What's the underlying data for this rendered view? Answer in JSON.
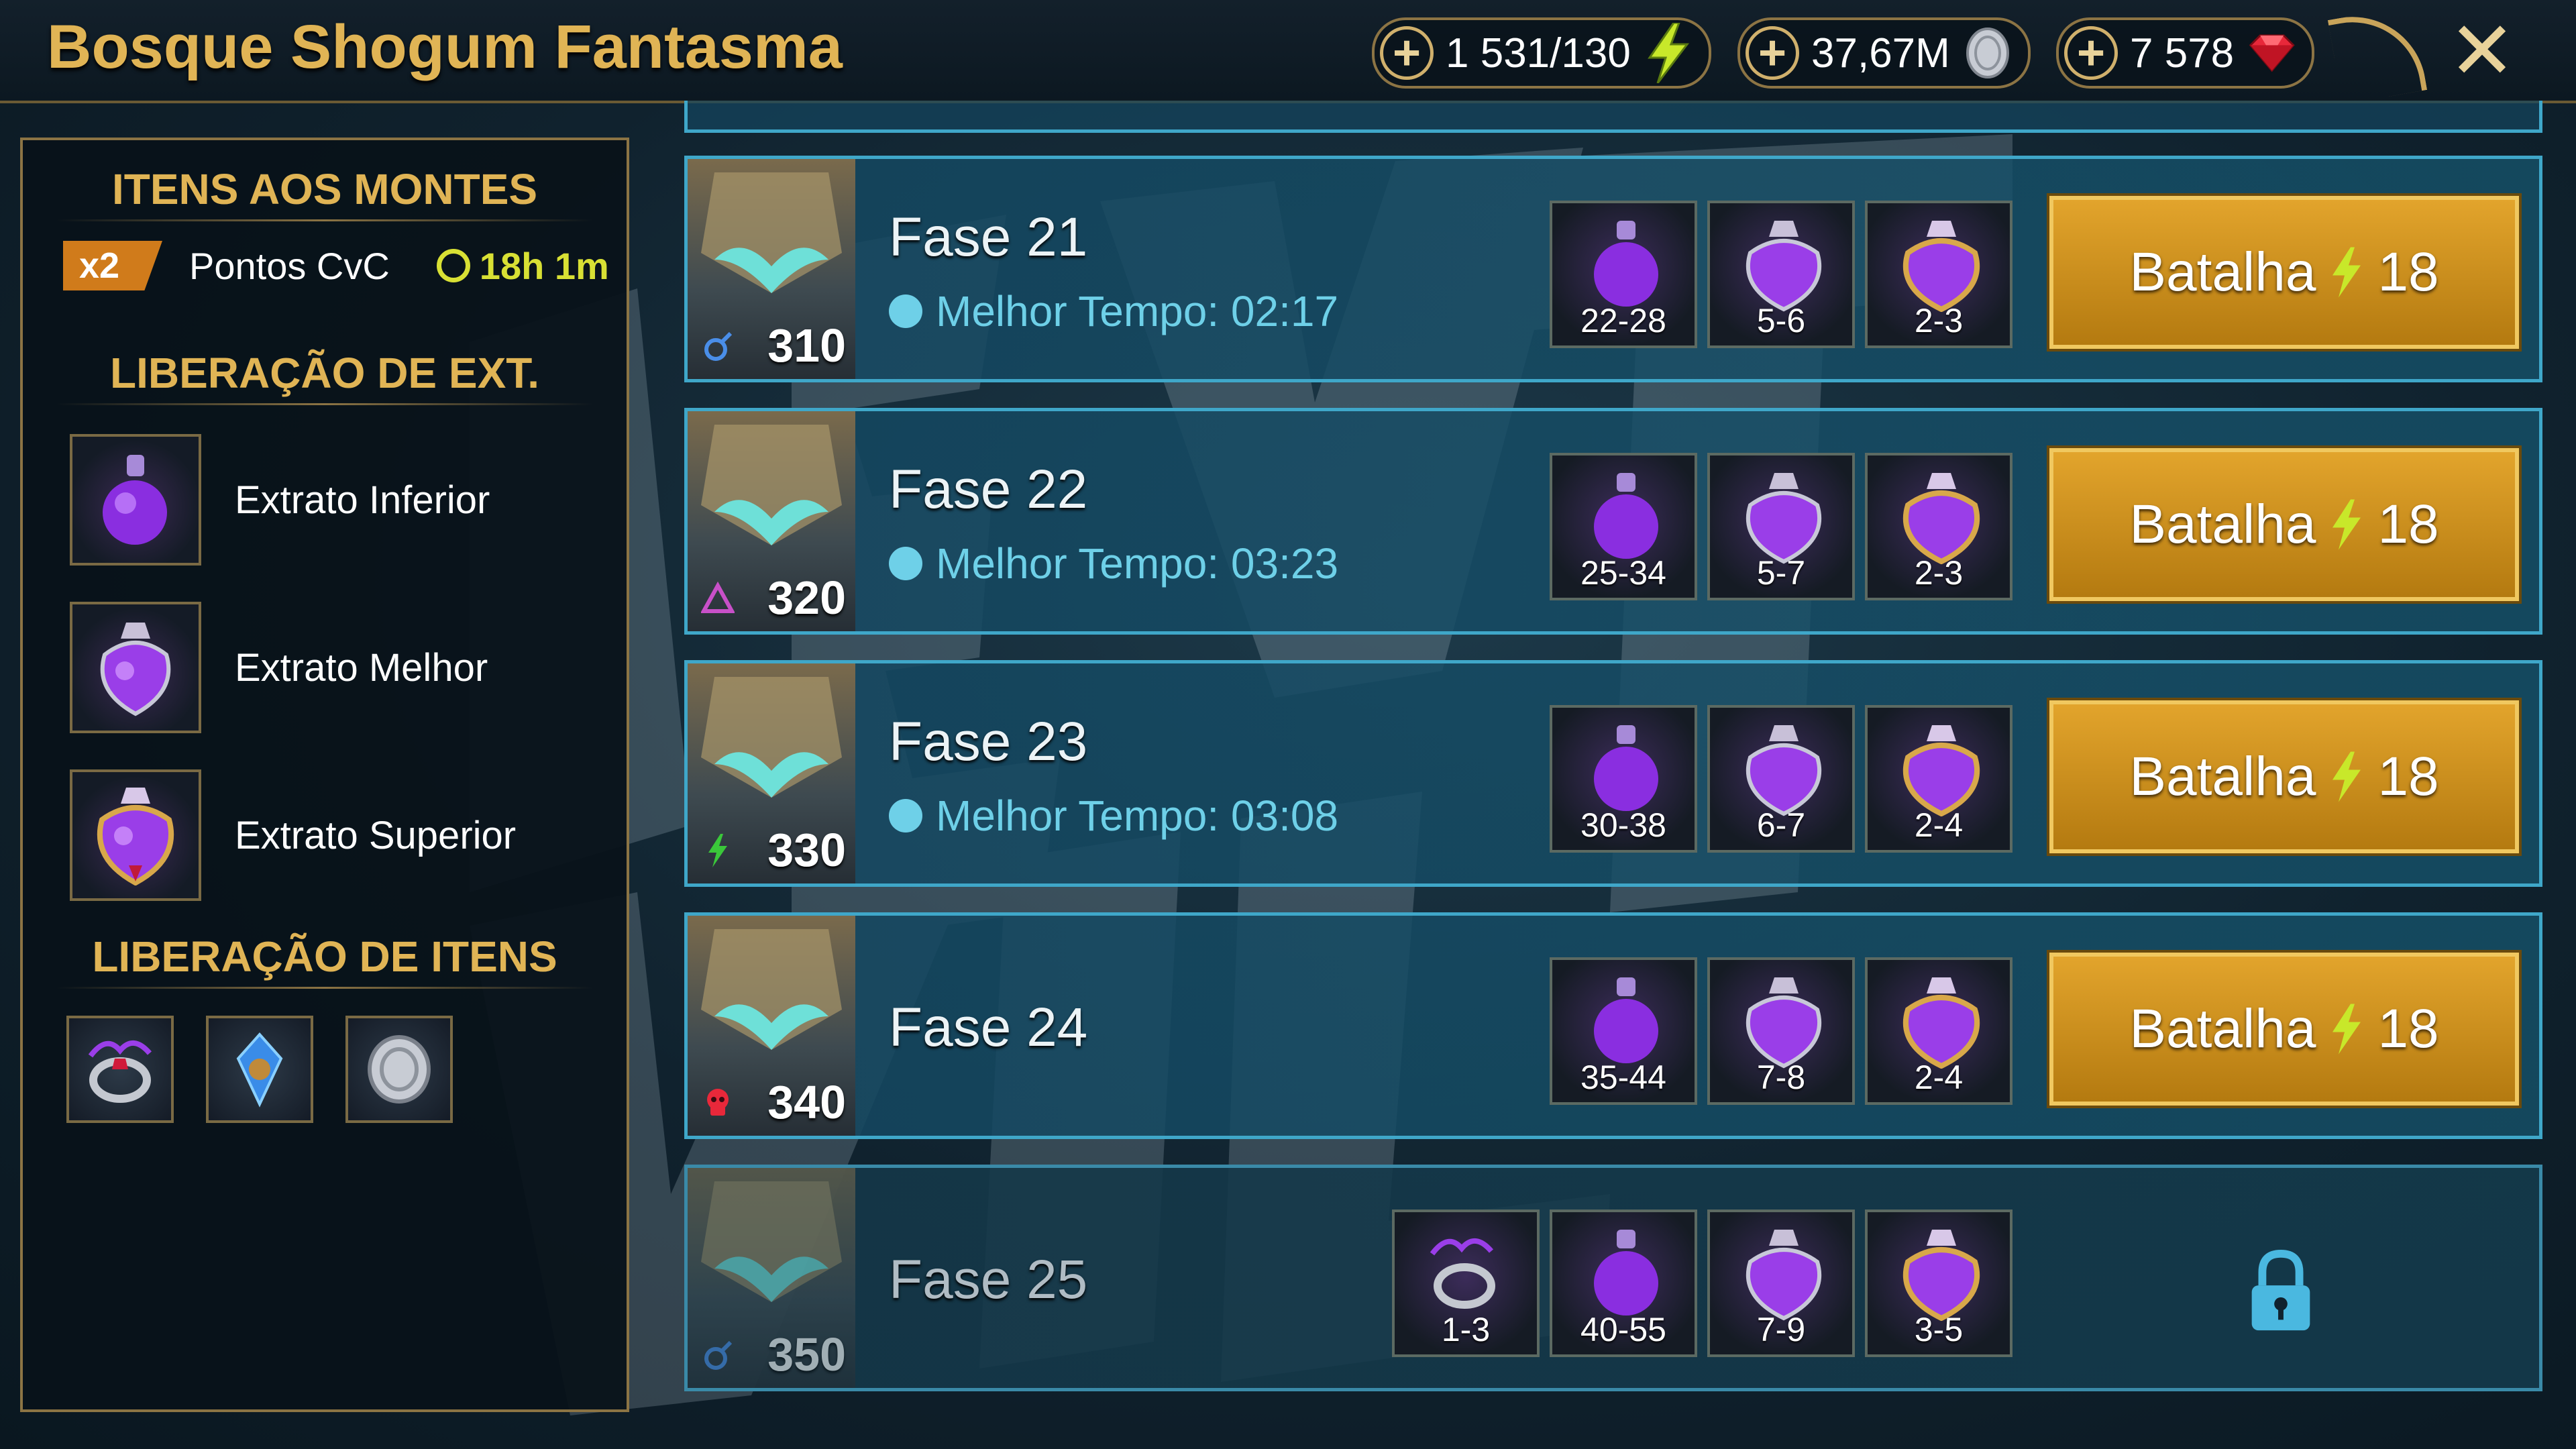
{
  "header": {
    "title": "Bosque Shogum Fantasma",
    "energy": "1 531/130",
    "silver": "37,67M",
    "gems": "7 578"
  },
  "sidebar": {
    "bonus_title": "ITENS AOS MONTES",
    "bonus_multiplier": "x2",
    "bonus_label": "Pontos CvC",
    "bonus_time": "18h 1m",
    "extract_title": "LIBERAÇÃO DE EXT.",
    "extracts": [
      {
        "label": "Extrato Inferior"
      },
      {
        "label": "Extrato Melhor"
      },
      {
        "label": "Extrato Superior"
      }
    ],
    "items_title": "LIBERAÇÃO DE ITENS"
  },
  "stages": [
    {
      "name": "Fase 21",
      "level": "310",
      "best_time": "Melhor Tempo: 02:17",
      "rewards": [
        "22-28",
        "5-6",
        "2-3"
      ],
      "battle_label": "Batalha",
      "cost": "18"
    },
    {
      "name": "Fase 22",
      "level": "320",
      "best_time": "Melhor Tempo: 03:23",
      "rewards": [
        "25-34",
        "5-7",
        "2-3"
      ],
      "battle_label": "Batalha",
      "cost": "18"
    },
    {
      "name": "Fase 23",
      "level": "330",
      "best_time": "Melhor Tempo: 03:08",
      "rewards": [
        "30-38",
        "6-7",
        "2-4"
      ],
      "battle_label": "Batalha",
      "cost": "18"
    },
    {
      "name": "Fase 24",
      "level": "340",
      "rewards": [
        "35-44",
        "7-8",
        "2-4"
      ],
      "battle_label": "Batalha",
      "cost": "18"
    },
    {
      "name": "Fase 25",
      "level": "350",
      "rewards": [
        "1-3",
        "40-55",
        "7-9",
        "3-5"
      ]
    }
  ],
  "colors": {
    "gold_title": "#e0b455",
    "stage_border": "#3fa7c9",
    "best_time": "#6ed0e8",
    "battle_button": "#d4951e",
    "bonus_time": "#d8e034"
  }
}
